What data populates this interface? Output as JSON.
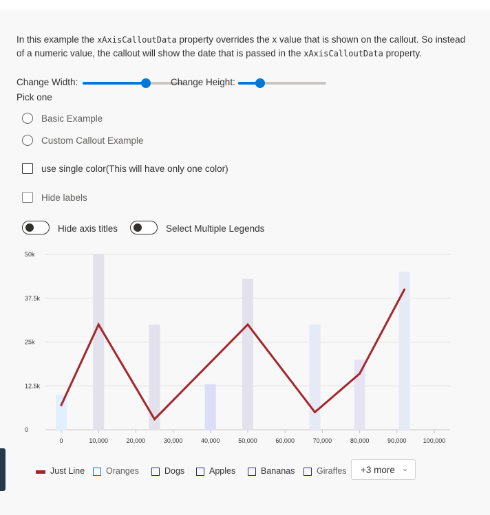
{
  "description": {
    "part1": "In this example the ",
    "code1": "xAxisCalloutData",
    "part2": " property overrides the x value that is shown on the callout. So instead of a numeric value, the callout will show the date that is passed in the ",
    "code2": "xAxisCalloutData",
    "part3": " property."
  },
  "controls": {
    "width_label": "Change Width:",
    "width_value": 0.62,
    "height_label": "Change Height:",
    "height_value": 0.25,
    "pick_label": "Pick one",
    "radios": [
      {
        "label": "Basic Example",
        "selected": false
      },
      {
        "label": "Custom Callout Example",
        "selected": false
      }
    ],
    "single_color_label": "use single color(This will have only one color)",
    "hide_labels_label": "Hide labels",
    "hide_axis_titles_label": "Hide axis titles",
    "select_multiple_label": "Select Multiple Legends"
  },
  "chart_data": {
    "type": "bar",
    "x_ticks": [
      "0",
      "10,000",
      "20,000",
      "30,000",
      "40,000",
      "50,000",
      "60,000",
      "70,000",
      "80,000",
      "90,000",
      "100,000"
    ],
    "y_ticks": [
      "0",
      "12.5k",
      "25k",
      "37.5k",
      "50k"
    ],
    "xlim": [
      0,
      100000
    ],
    "ylim": [
      0,
      50000
    ],
    "bars": [
      {
        "x": 0,
        "y": 10000,
        "color": "#e1efff"
      },
      {
        "x": 10000,
        "y": 50000,
        "color": "#e3e2ec"
      },
      {
        "x": 25000,
        "y": 30000,
        "color": "#e3e2ec"
      },
      {
        "x": 40000,
        "y": 13000,
        "color": "#ddddfa"
      },
      {
        "x": 50000,
        "y": 43000,
        "color": "#e3e2ec"
      },
      {
        "x": 68000,
        "y": 30000,
        "color": "#e6e9f6"
      },
      {
        "x": 80000,
        "y": 20000,
        "color": "#e6e4f4"
      },
      {
        "x": 92000,
        "y": 45000,
        "color": "#e6eaf4"
      }
    ],
    "line": {
      "name": "Just Line",
      "color": "#a4262c",
      "points": [
        [
          0,
          7000
        ],
        [
          10000,
          30000
        ],
        [
          25000,
          3000
        ],
        [
          50000,
          30000
        ],
        [
          68000,
          5000
        ],
        [
          80000,
          16000
        ],
        [
          92000,
          40000
        ]
      ]
    }
  },
  "legend": {
    "items": [
      {
        "label": "Just Line",
        "type": "line",
        "color": "#a4262c"
      },
      {
        "label": "Oranges",
        "type": "box",
        "color": "#0078d4"
      },
      {
        "label": "Dogs",
        "type": "box",
        "color": "#2b2b70"
      },
      {
        "label": "Apples",
        "type": "box",
        "color": "#2b2b70"
      },
      {
        "label": "Bananas",
        "type": "box",
        "color": "#2b2b70"
      },
      {
        "label": "Giraffes",
        "type": "box",
        "color": "#2b2b70"
      }
    ],
    "more_label": "+3 more"
  }
}
